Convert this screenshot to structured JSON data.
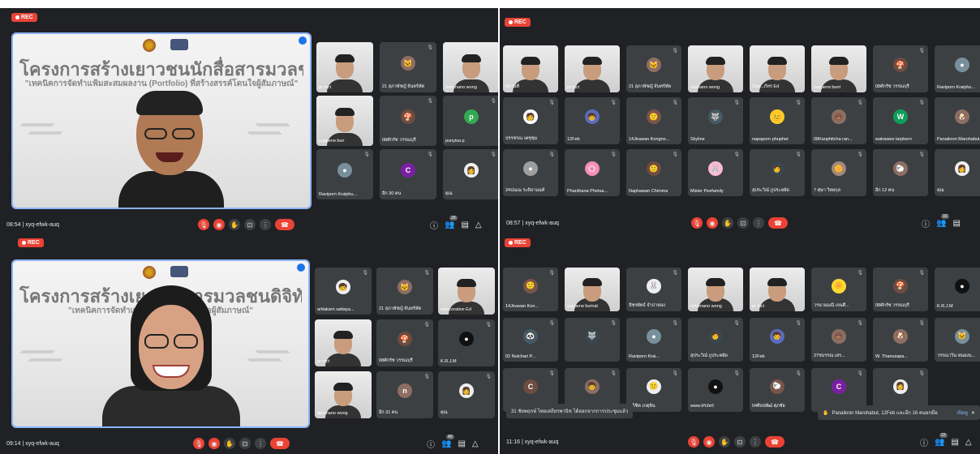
{
  "rec_label": "REC",
  "slide": {
    "title": "โครงการสร้างเยาวชนนักสื่อสารมวลชนดิจิทัล",
    "subtitle": "\"เทคนิคการจัดทำแฟ้มสะสมผลงาน (Portfolio) ที่สร้างสรรค์โดนใจผู้สัมภาษณ์\"",
    "title_partial": "โครงการสร้างเยาวช      สารมวลชนดิจิทัล",
    "subtitle_partial": "\"เทคนิคการจัดทำแฟ้มสะสม                      สรรค์โดนใจผู้สัมภาษณ์\""
  },
  "panels": [
    {
      "meta": "08:54 | xyq-efwk-auq",
      "tiles": [
        {
          "name": "pr mct",
          "kind": "video"
        },
        {
          "name": "21 สุภาพัชญ์ จันทร์หัต",
          "kind": "avatar",
          "color": "#8d6e63",
          "glyph": "🐱"
        },
        {
          "name": "ostomano wong",
          "kind": "video"
        },
        {
          "name": "supperw bun",
          "kind": "video"
        },
        {
          "name": "08ศักรัช วรรณบุรี",
          "kind": "avatar",
          "color": "#6d4c41",
          "glyph": "🍄"
        },
        {
          "name": "punyisa p",
          "kind": "letter",
          "color": "#34a853",
          "glyph": "p"
        },
        {
          "name": "Raviporn Kralphu...",
          "kind": "avatar",
          "color": "#78909c",
          "glyph": "●"
        },
        {
          "name": "อีก 30 คน",
          "kind": "letter",
          "color": "#7b1fa2",
          "glyph": "C"
        },
        {
          "name": "คุณ",
          "kind": "avatar",
          "color": "#eeeeee",
          "glyph": "👩"
        }
      ],
      "participants": "29"
    },
    {
      "meta": "08:57 | xyq-efwk-auq",
      "tiles": [
        {
          "name": "สถานที่",
          "kind": "video"
        },
        {
          "name": "pr mct",
          "kind": "video"
        },
        {
          "name": "21 สุภาพัชญ์ จันทร์หัต",
          "kind": "avatar",
          "color": "#8d6e63",
          "glyph": "🐱"
        },
        {
          "name": "otamano wong",
          "kind": "video"
        },
        {
          "name": "Cha...ภัทร Ed",
          "kind": "video"
        },
        {
          "name": "supperw bunt",
          "kind": "video"
        },
        {
          "name": "08ศักรัช วรรณบุรี",
          "kind": "avatar",
          "color": "#6d4c41",
          "glyph": "🍄"
        },
        {
          "name": "Raviporn Kraiphu...",
          "kind": "avatar",
          "color": "#78909c",
          "glyph": "●"
        },
        {
          "name": "ปรรชรณ เตชุชุม",
          "kind": "avatar",
          "color": "#ffffff",
          "glyph": "🧑"
        },
        {
          "name": "12Feb",
          "kind": "avatar",
          "color": "#5c6bc0",
          "glyph": "🧒"
        },
        {
          "name": "14Jirawan Kongno...",
          "kind": "avatar",
          "color": "#795548",
          "glyph": "🙂"
        },
        {
          "name": "Skyline",
          "kind": "avatar",
          "color": "#455a64",
          "glyph": "🐺"
        },
        {
          "name": "napaporn phuphet",
          "kind": "avatar",
          "color": "#ffca28",
          "glyph": "😊"
        },
        {
          "name": "08Kanphitcha ran...",
          "kind": "avatar",
          "color": "#8d6e63",
          "glyph": "🐻"
        },
        {
          "name": "watrawee larpkern",
          "kind": "letter",
          "color": "#0f9d58",
          "glyph": "W"
        },
        {
          "name": "Panaikron Marohabut",
          "kind": "avatar",
          "color": "#8d6e63",
          "glyph": "🐶"
        },
        {
          "name": "24ปณณ ระดิยานนท์",
          "kind": "avatar",
          "color": "#9e9e9e",
          "glyph": "●"
        },
        {
          "name": "Phanthana Phetsa...",
          "kind": "avatar",
          "color": "#f48fb1",
          "glyph": "🌸"
        },
        {
          "name": "Naphawan Chimma",
          "kind": "avatar",
          "color": "#6d4c41",
          "glyph": "🙂"
        },
        {
          "name": "Mister Peefamily",
          "kind": "avatar",
          "color": "#f8bbd0",
          "glyph": "🐰"
        },
        {
          "name": "สุประวิณ์ ภูประหยัด",
          "kind": "avatar",
          "color": "#37474f",
          "glyph": "🧑"
        },
        {
          "name": "7 ศุษา วิทยกุล",
          "kind": "avatar",
          "color": "#a1887f",
          "glyph": "🌼"
        },
        {
          "name": "อีก 12 คน",
          "kind": "letter",
          "color": "#8d6e63",
          "glyph": "🐑"
        },
        {
          "name": "คุณ",
          "kind": "avatar",
          "color": "#eeeeee",
          "glyph": "👩"
        }
      ],
      "participants": "33"
    },
    {
      "meta": "09:14 | xyq-efwk-auq",
      "tiles": [
        {
          "name": "arttakarn sattaya...",
          "kind": "avatar",
          "color": "#eeeeee",
          "glyph": "🧒"
        },
        {
          "name": "21 สุภาพัชญ์ จันทร์หัต",
          "kind": "avatar",
          "color": "#8d6e63",
          "glyph": "🐱"
        },
        {
          "name": "ostocorative Ed",
          "kind": "video"
        },
        {
          "name": "pr mct",
          "kind": "video"
        },
        {
          "name": "08ศักรัช วรรณบุรี",
          "kind": "avatar",
          "color": "#6d4c41",
          "glyph": "🍄"
        },
        {
          "name": "K.R.J.M",
          "kind": "avatar",
          "color": "#111111",
          "glyph": "●"
        },
        {
          "name": "apemano wong",
          "kind": "video"
        },
        {
          "name": "อีก 31 คน",
          "kind": "letter",
          "color": "#8d6e63",
          "glyph": "n"
        },
        {
          "name": "คุณ",
          "kind": "avatar",
          "color": "#eeeeee",
          "glyph": "👩"
        }
      ],
      "participants": "40"
    },
    {
      "meta": "11:16 | xyq-efwk-auq",
      "tiles": [
        {
          "name": "14Jirawan Kon...",
          "kind": "avatar",
          "color": "#795548",
          "glyph": "🙂"
        },
        {
          "name": "supperw burirat",
          "kind": "video"
        },
        {
          "name": "ปัชรพัทธ์ จำปาทอง",
          "kind": "avatar",
          "color": "#eeeeee",
          "glyph": "🐰"
        },
        {
          "name": "ostamano wong",
          "kind": "video"
        },
        {
          "name": "pr mct",
          "kind": "video"
        },
        {
          "name": "วรนามมณี เจนศี...",
          "kind": "avatar",
          "color": "#fdd835",
          "glyph": "🌼"
        },
        {
          "name": "08ศักรัช วรรณบุรี",
          "kind": "avatar",
          "color": "#6d4c41",
          "glyph": "🍄"
        },
        {
          "name": "K.R.J.M",
          "kind": "avatar",
          "color": "#111111",
          "glyph": "●"
        },
        {
          "name": "02 Nutchari P...",
          "kind": "avatar",
          "color": "#455a64",
          "glyph": "🐼"
        },
        {
          "name": "",
          "kind": "avatar",
          "color": "#37474f",
          "glyph": "🐺"
        },
        {
          "name": "Raviporn Krai...",
          "kind": "avatar",
          "color": "#78909c",
          "glyph": "●"
        },
        {
          "name": "สุประวิณ์ ภูประหยัด",
          "kind": "avatar",
          "color": "#37474f",
          "glyph": "🧑"
        },
        {
          "name": "12Feb",
          "kind": "avatar",
          "color": "#5c6bc0",
          "glyph": "🧒"
        },
        {
          "name": "27ชบรรณ เสร...",
          "kind": "avatar",
          "color": "#8d6e63",
          "glyph": "🐻"
        },
        {
          "name": "W. Thanusapa...",
          "kind": "avatar",
          "color": "#8d6e63",
          "glyph": "🐶"
        },
        {
          "name": "วรรณาวิน หนองบ...",
          "kind": "avatar",
          "color": "#78909c",
          "glyph": "🐱"
        },
        {
          "name": "",
          "kind": "letter",
          "color": "#6d4c41",
          "glyph": "C"
        },
        {
          "name": "",
          "kind": "avatar",
          "color": "#8d6e63",
          "glyph": "🧒"
        },
        {
          "name": "4.วิชิต เกตุพิน",
          "kind": "avatar",
          "color": "#eeeeee",
          "glyph": "🙂"
        },
        {
          "name": "www.ทรงพร",
          "kind": "avatar",
          "color": "#111111",
          "glyph": "●"
        },
        {
          "name": "04ศิลปพัฒ์ ศุภชัย",
          "kind": "avatar",
          "color": "#795548",
          "glyph": "🐑"
        },
        {
          "name": "",
          "kind": "letter",
          "color": "#7b1fa2",
          "glyph": "C"
        },
        {
          "name": "",
          "kind": "avatar",
          "color": "#eeeeee",
          "glyph": "👩"
        }
      ],
      "participants": "22",
      "toast_left": "31 ชัยพฤกษ์ ไทยเสถียรพานิช ได้ออกจากการประชุมแล้ว",
      "toast_right": "Panaikron Marohabut, 12Feb และอีก 16 คนยกมือ",
      "toast_right_link": "เปิดดู"
    }
  ],
  "colors": {
    "bg": "#202124",
    "tile": "#3c4043",
    "red": "#ea4335",
    "blue": "#8ab4f8"
  }
}
